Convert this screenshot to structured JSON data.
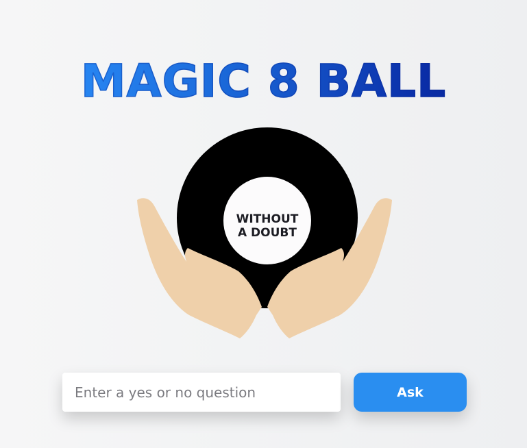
{
  "header": {
    "title": "MAGIC 8 BALL"
  },
  "ball": {
    "answer_line_1": "WITHOUT",
    "answer_line_2": "A DOUBT"
  },
  "form": {
    "question_placeholder": "Enter a yes or no question",
    "question_value": "",
    "ask_label": "Ask"
  },
  "colors": {
    "title_gradient_start": "#2e95ff",
    "title_gradient_end": "#071f8e",
    "ball": "#000000",
    "window": "#fcfbfc",
    "hands": "#efd0aa",
    "ask_button": "#2a8ef0"
  }
}
